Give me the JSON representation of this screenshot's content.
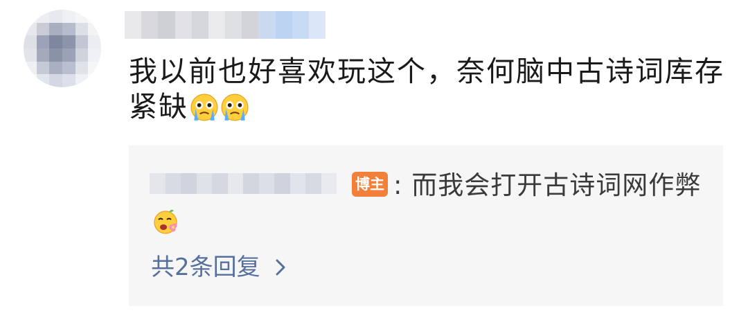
{
  "comment": {
    "text": "我以前也好喜欢玩这个，奈何脑中古诗词库存紧缺",
    "emojis": [
      "crying-emoji",
      "crying-emoji"
    ]
  },
  "reply": {
    "badge": "博主",
    "text": ": 而我会打开古诗词网作弊",
    "emoji": "flower-face-emoji"
  },
  "more_replies": {
    "label": "共2条回复",
    "icon": "chevron-right-icon"
  },
  "colors": {
    "link": "#56709e",
    "badge": "#f2803a",
    "reply_bg": "#f6f6f6"
  }
}
